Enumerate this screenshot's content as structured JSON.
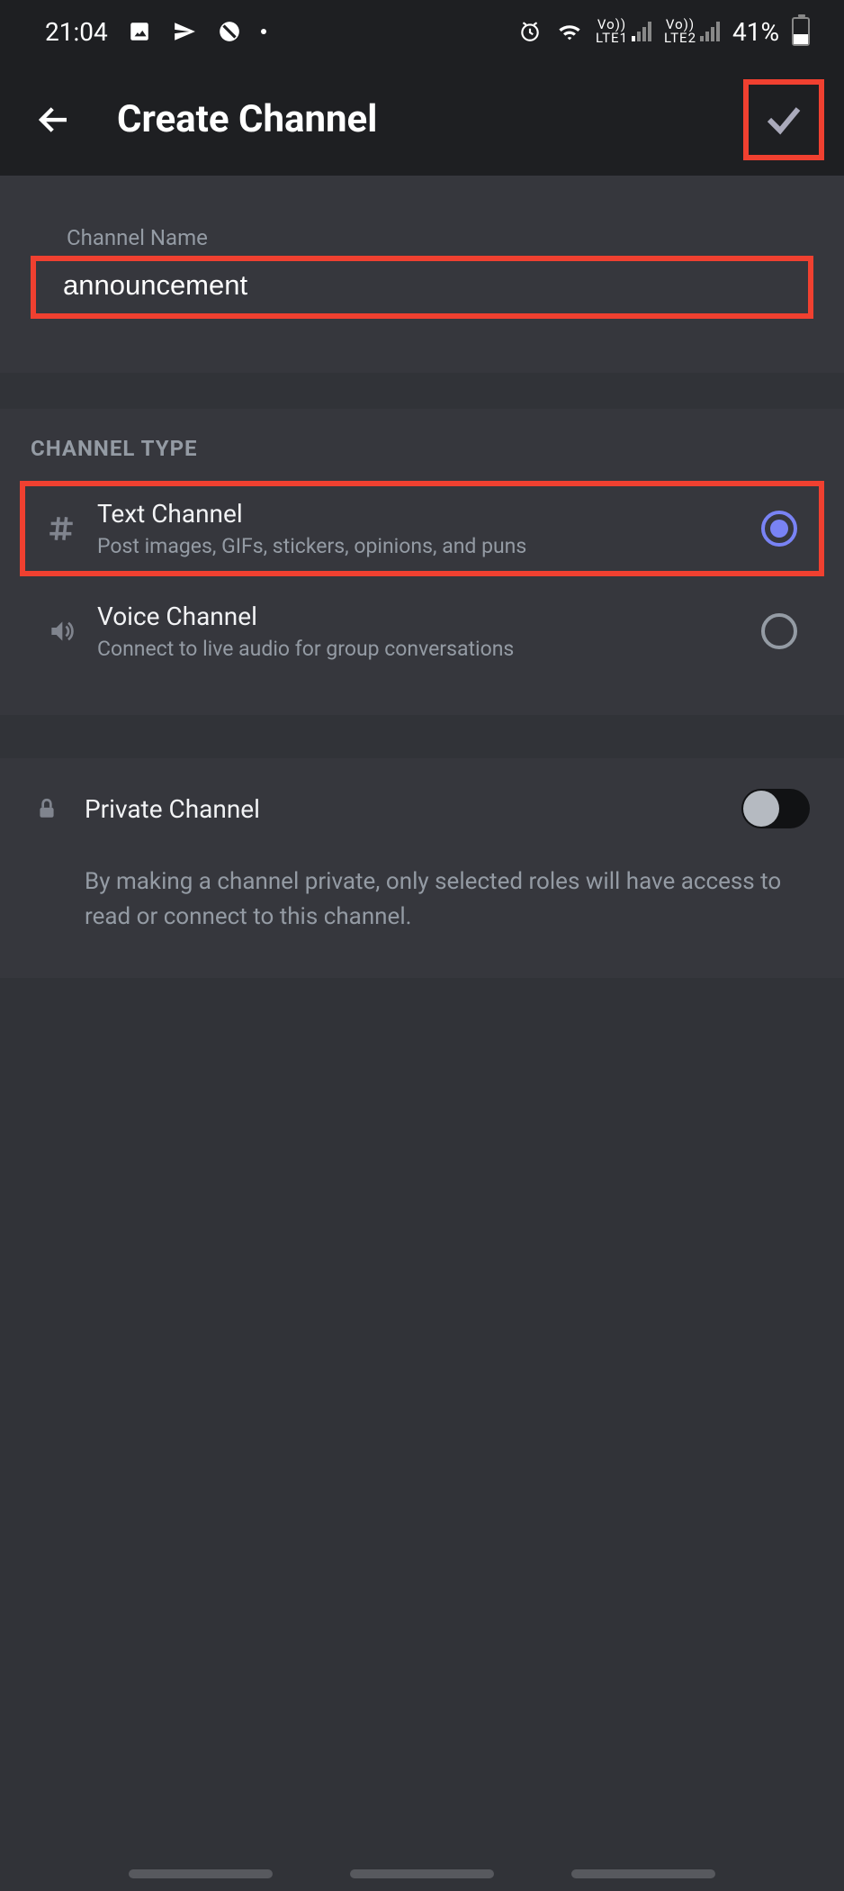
{
  "status_bar": {
    "time": "21:04",
    "lte1": "LTE1",
    "lte2": "LTE2",
    "vo": "Vo))",
    "battery_pct": "41%"
  },
  "header": {
    "title": "Create Channel"
  },
  "channel_name": {
    "label": "Channel Name",
    "value": "announcement"
  },
  "channel_type": {
    "header": "CHANNEL TYPE",
    "text": {
      "title": "Text Channel",
      "subtitle": "Post images, GIFs, stickers, opinions, and puns"
    },
    "voice": {
      "title": "Voice Channel",
      "subtitle": "Connect to live audio for group conversations"
    }
  },
  "private": {
    "label": "Private Channel",
    "description": "By making a channel private, only selected roles will have access to read or connect to this channel."
  }
}
